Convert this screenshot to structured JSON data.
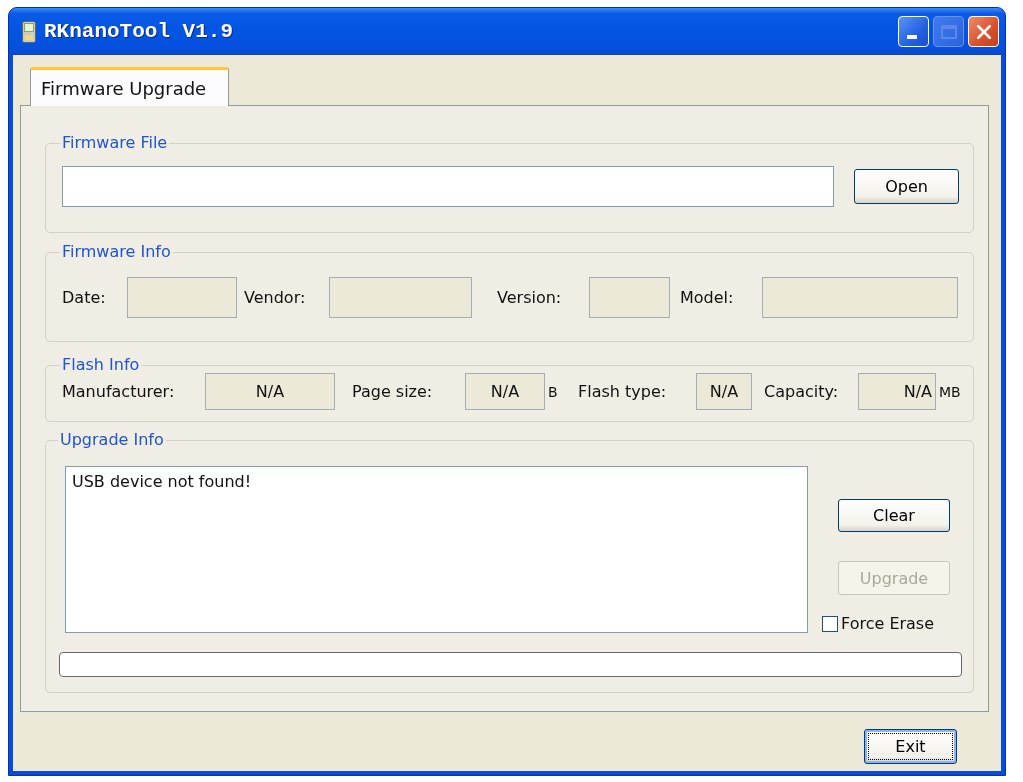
{
  "window": {
    "title": "RKnanoTool V1.9",
    "controls": [
      {
        "kind": "minimize",
        "disabled": false
      },
      {
        "kind": "maximize",
        "disabled": true
      },
      {
        "kind": "close",
        "disabled": false
      }
    ]
  },
  "tabs": [
    {
      "label": "Firmware Upgrade",
      "selected": true
    }
  ],
  "firmware_file": {
    "legend": "Firmware File",
    "button": {
      "label": "Open",
      "disabled": false
    }
  },
  "firmware_info": {
    "legend": "Firmware Info",
    "fields": [
      {
        "label": "Date:"
      },
      {
        "label": "Vendor:"
      },
      {
        "label": "Version:"
      },
      {
        "label": "Model:"
      }
    ]
  },
  "flash_info": {
    "legend": "Flash Info",
    "fields": [
      {
        "label": "Manufacturer:",
        "value": "N/A"
      },
      {
        "label": "Page size:",
        "value": "N/A",
        "unit": "B"
      },
      {
        "label": "Flash type:",
        "value": "N/A"
      },
      {
        "label": "Capacity:",
        "value": "N/A",
        "unit": "MB"
      }
    ]
  },
  "upgrade_info": {
    "legend": "Upgrade Info",
    "log": "USB device not found!",
    "buttons": [
      {
        "label": "Clear",
        "disabled": false
      },
      {
        "label": "Upgrade",
        "disabled": true
      }
    ],
    "force_erase": {
      "label": "Force Erase",
      "checked": false
    },
    "progress": {
      "level": 0
    }
  },
  "footer": {
    "buttons": [
      {
        "label": "Exit",
        "focused": true
      }
    ]
  }
}
